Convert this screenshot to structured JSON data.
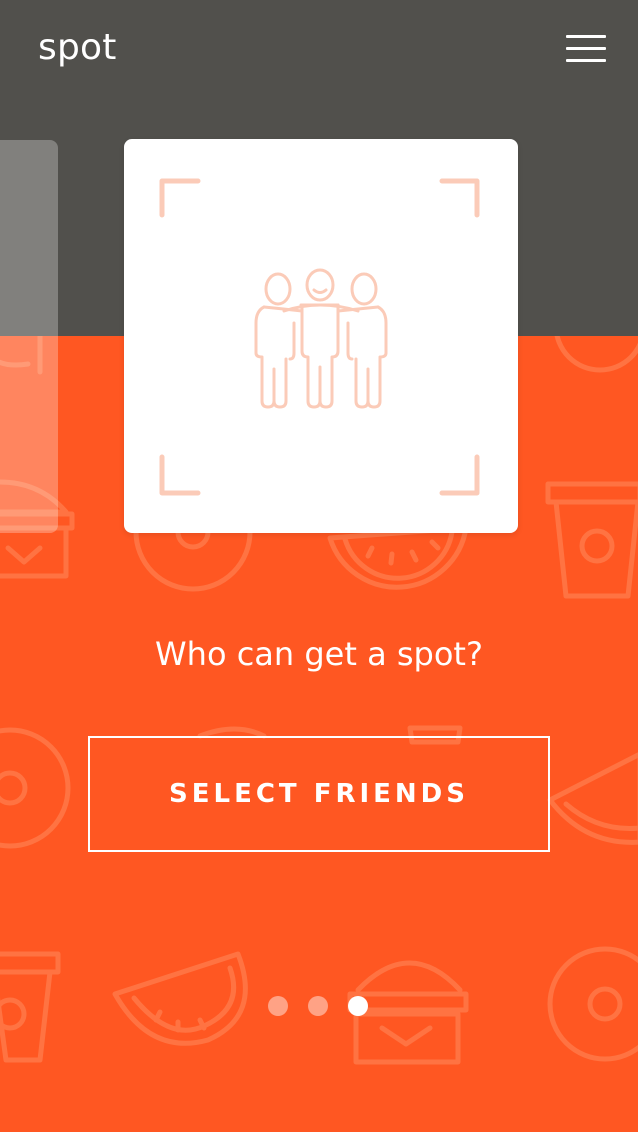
{
  "app": {
    "logo_text": "spot"
  },
  "header": {
    "menu_icon": "hamburger-menu-icon"
  },
  "card": {
    "icon": "group-of-friends-icon",
    "frame_icon": "viewfinder-corners-icon"
  },
  "prompt": {
    "question": "Who can get a spot?"
  },
  "actions": {
    "select_friends_label": "SELECT FRIENDS"
  },
  "pagination": {
    "total_pages": 3,
    "current_page": 3
  },
  "colors": {
    "header_background": "#51504c",
    "accent_background": "#ff5722",
    "card_background": "#ffffff",
    "card_icon_stroke": "#fbcbb8",
    "text": "#ffffff"
  },
  "background_pattern_icons": [
    "donut-icon",
    "watermelon-slice-icon",
    "coffee-cup-icon",
    "burger-icon"
  ]
}
